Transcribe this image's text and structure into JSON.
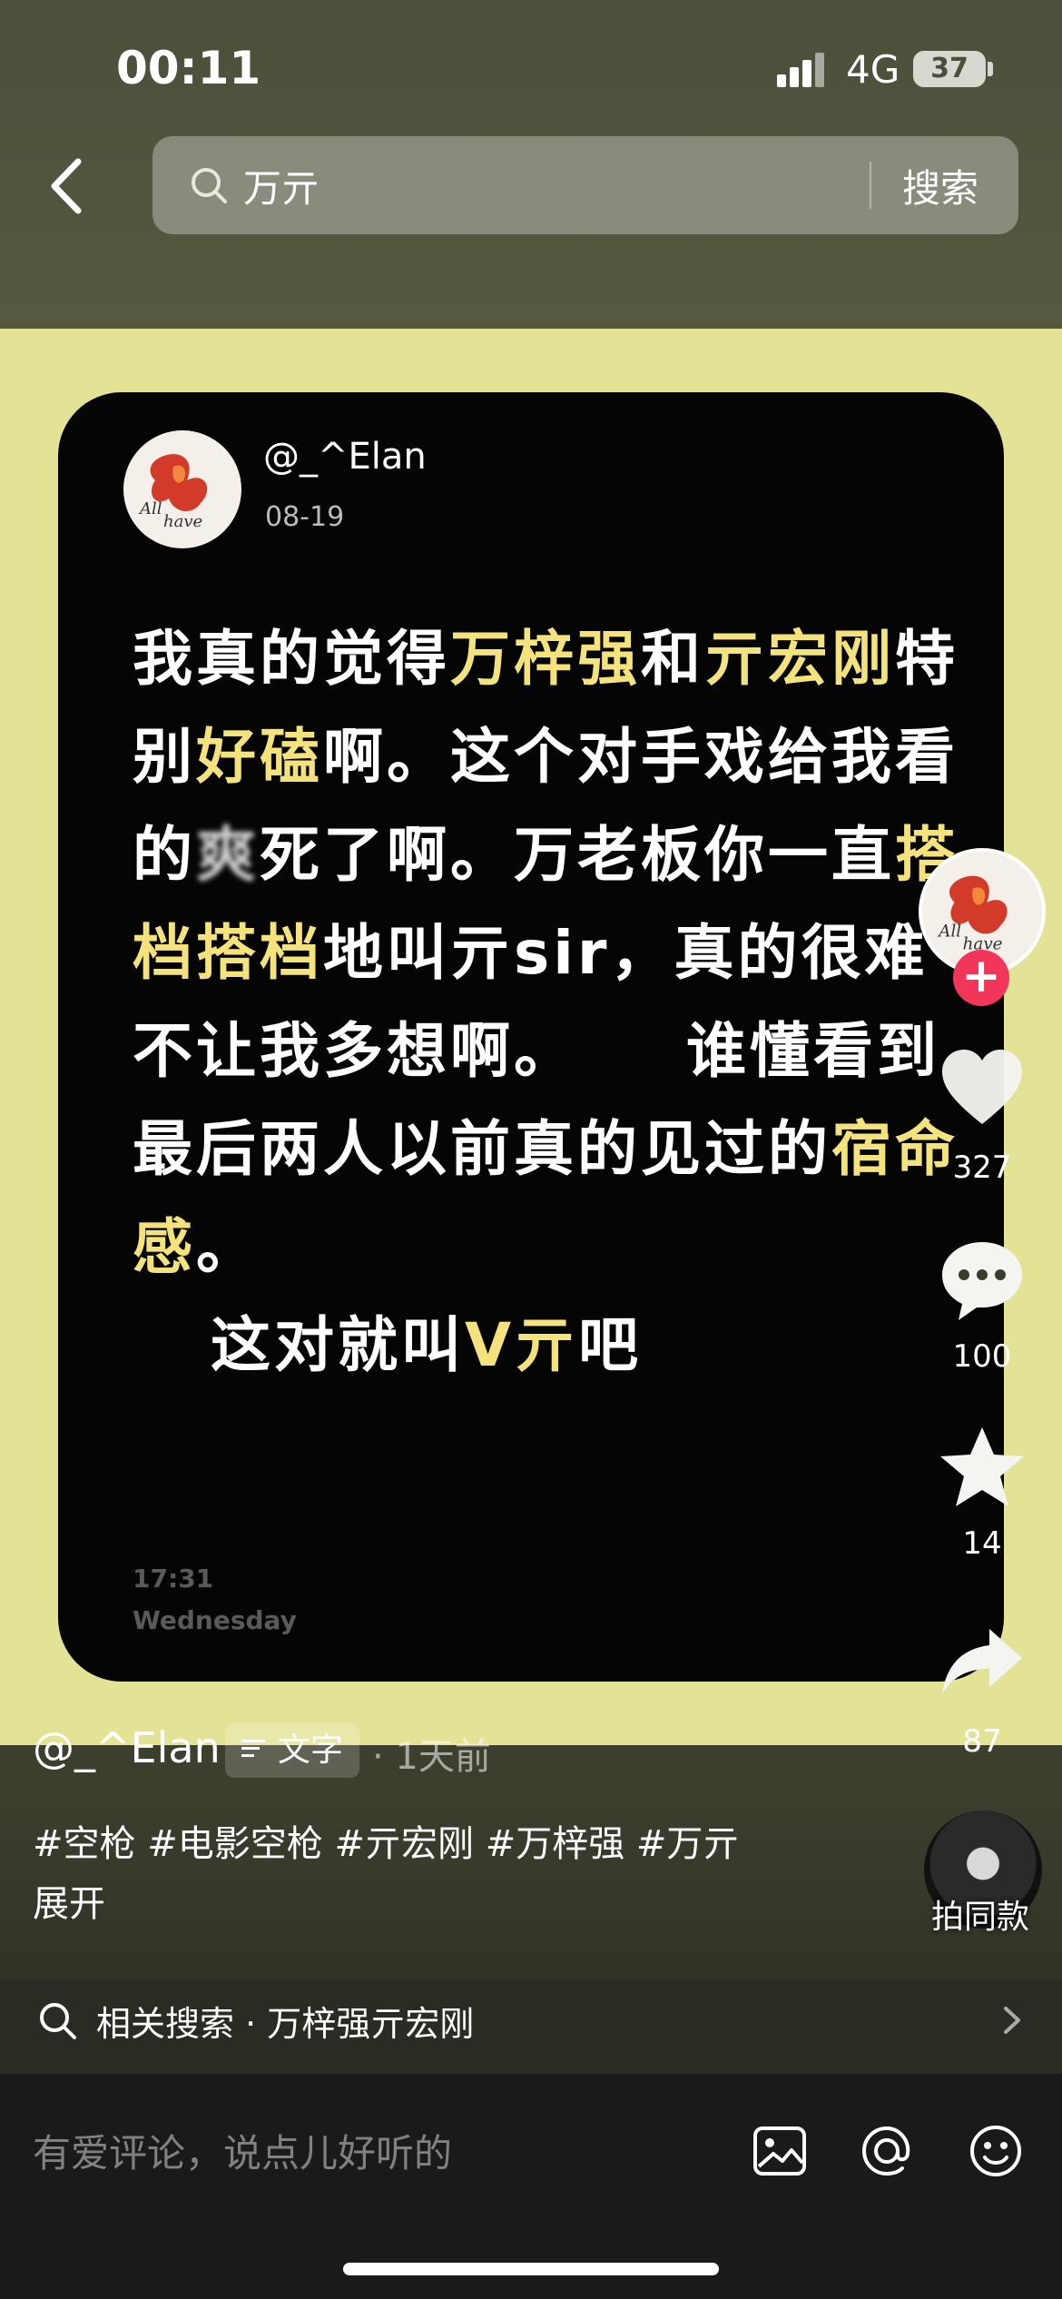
{
  "status_bar": {
    "time": "00:11",
    "network": "4G",
    "battery": "37"
  },
  "search": {
    "query": "万亓",
    "button": "搜索"
  },
  "card": {
    "username": "@_^Elan",
    "date": "08-19",
    "text_segments": {
      "s1": "我真的觉得",
      "h1": "万梓强",
      "s2": "和",
      "h2": "亓宏刚",
      "s3": "特别",
      "h3": "好磕",
      "s4": "啊。这个对手戏给我看的",
      "blurred": "爽",
      "s5": "死了啊。万老板你一直",
      "h4": "搭档搭档",
      "s6": "地叫亓sir，真的很难不让我多想啊。",
      "s7": "谁懂看到最后两人以前真的见过的",
      "h5": "宿命感",
      "s8": "。",
      "final_pre": "这对就叫",
      "final_hl": "V亓",
      "final_post": "吧"
    },
    "clock": "17:31",
    "weekday": "Wednesday"
  },
  "actions": {
    "likes": "327",
    "comments": "100",
    "favorites": "14",
    "shares": "87"
  },
  "caption": {
    "username": "@_^Elan",
    "tag": "文字",
    "time": "· 1天前",
    "hashtags": "#空枪 #电影空枪 #亓宏刚 #万梓强 #万亓",
    "expand": "展开"
  },
  "music": {
    "label": "拍同款"
  },
  "related": {
    "text": "相关搜索 · 万梓强亓宏刚"
  },
  "comment_bar": {
    "placeholder": "有爱评论，说点儿好听的"
  },
  "colors": {
    "highlight": "#f4e27c",
    "follow": "#f2365a",
    "band": "#e3e396"
  },
  "icons": [
    "back-icon",
    "search-icon",
    "heart-icon",
    "comment-icon",
    "star-icon",
    "share-icon",
    "image-icon",
    "at-icon",
    "emoji-icon",
    "chevron-right-icon",
    "text-lines-icon"
  ]
}
